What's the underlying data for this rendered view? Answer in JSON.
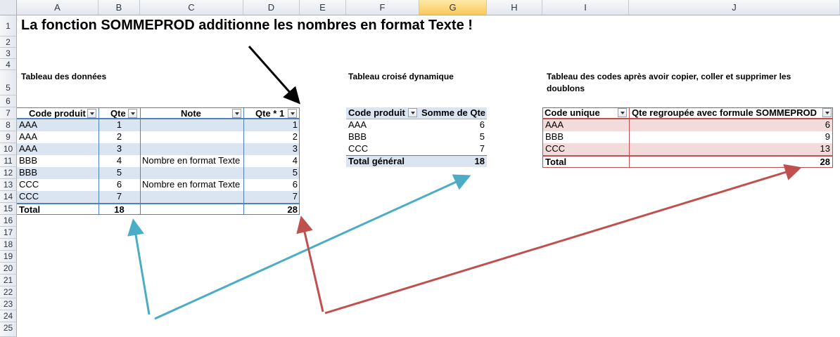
{
  "columns": [
    "A",
    "B",
    "C",
    "D",
    "E",
    "F",
    "G",
    "H",
    "I",
    "J"
  ],
  "rows": [
    "1",
    "2",
    "3",
    "4",
    "5",
    "6",
    "7",
    "8",
    "9",
    "10",
    "11",
    "12",
    "13",
    "14",
    "15",
    "16",
    "17",
    "18",
    "19",
    "20",
    "21",
    "22",
    "23",
    "24",
    "25"
  ],
  "title": "La fonction SOMMEPROD additionne les nombres en format Texte !",
  "data_table": {
    "caption": "Tableau des données",
    "headers": [
      "Code produit",
      "Qte",
      "Note",
      "Qte * 1"
    ],
    "rows": [
      {
        "code": "AAA",
        "qte": "1",
        "note": "",
        "qte1": "1"
      },
      {
        "code": "AAA",
        "qte": "2",
        "note": "",
        "qte1": "2"
      },
      {
        "code": "AAA",
        "qte": "3",
        "note": "",
        "qte1": "3"
      },
      {
        "code": "BBB",
        "qte": "4",
        "note": "Nombre en format Texte",
        "qte1": "4"
      },
      {
        "code": "BBB",
        "qte": "5",
        "note": "",
        "qte1": "5"
      },
      {
        "code": "CCC",
        "qte": "6",
        "note": "Nombre en format Texte",
        "qte1": "6"
      },
      {
        "code": "CCC",
        "qte": "7",
        "note": "",
        "qte1": "7"
      }
    ],
    "total": {
      "label": "Total",
      "qte": "18",
      "qte1": "28"
    }
  },
  "pivot_table": {
    "caption": "Tableau croisé dynamique",
    "headers": [
      "Code produit",
      "Somme de Qte"
    ],
    "rows": [
      {
        "code": "AAA",
        "sum": "6"
      },
      {
        "code": "BBB",
        "sum": "5"
      },
      {
        "code": "CCC",
        "sum": "7"
      }
    ],
    "total": {
      "label": "Total général",
      "sum": "18"
    }
  },
  "codes_table": {
    "caption_line1": "Tableau des codes après avoir copier, coller et supprimer les",
    "caption_line2": "doublons",
    "headers": [
      "Code unique",
      "Qte regroupée avec formule SOMMEPROD"
    ],
    "rows": [
      {
        "code": "AAA",
        "qte": "6"
      },
      {
        "code": "BBB",
        "qte": "9"
      },
      {
        "code": "CCC",
        "qte": "13"
      }
    ],
    "total": {
      "label": "Total",
      "qte": "28"
    }
  },
  "colors": {
    "blue_arrow": "#4bacc6",
    "red_arrow": "#c0504d",
    "black_arrow": "#000000",
    "table_blue": "#4f81bd",
    "band_blue": "#dbe5f1",
    "band_red": "#f2dcdb"
  }
}
